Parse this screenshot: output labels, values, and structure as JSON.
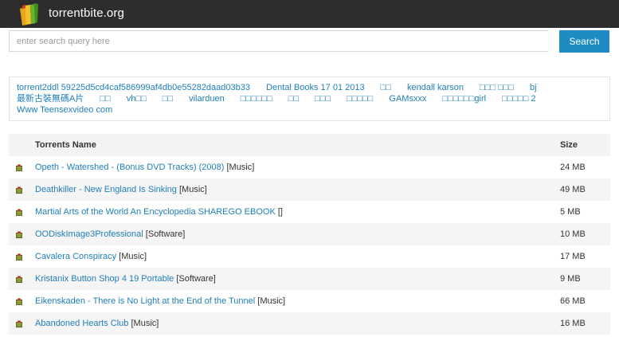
{
  "header": {
    "site_title": "torrentbite.org",
    "logo_icon": "books-logo-icon"
  },
  "search": {
    "placeholder": "enter search query here",
    "value": "",
    "button_label": "Search"
  },
  "tags": [
    "torrent2ddl 59225d5cd4caf586999af4db0e55282daad03b33",
    "Dental Books 17 01 2013",
    "□□",
    "kendall karson",
    "□□□ □□□",
    "bj",
    "最新古裝無碼A片",
    "□□",
    "vh□□",
    "□□",
    "vilarduen",
    "□□□□□□",
    "□□",
    "□□□",
    "□□□□□",
    "GAMsxxx",
    "□□□□□□girl",
    "□□□□□ 2",
    "Www Teensexvideo com"
  ],
  "table": {
    "columns": [
      "Torrents Name",
      "Size"
    ],
    "rows": [
      {
        "name": "Opeth - Watershed - (Bonus DVD Tracks) (2008)",
        "category": "[Music]",
        "size": "24 MB"
      },
      {
        "name": "Deathkiller - New England Is Sinking",
        "category": "[Music]",
        "size": "49 MB"
      },
      {
        "name": "Martial Arts of the World An Encyclopedia SHAREGO EBOOK",
        "category": "[]",
        "size": "5 MB"
      },
      {
        "name": "OODiskImage3Professional",
        "category": "[Software]",
        "size": "10 MB"
      },
      {
        "name": "Cavalera Conspiracy",
        "category": "[Music]",
        "size": "17 MB"
      },
      {
        "name": "Kristanix Button Shop 4 19 Portable",
        "category": "[Software]",
        "size": "9 MB"
      },
      {
        "name": "Eikenskaden - There is No Light at the End of the Tunnel",
        "category": "[Music]",
        "size": "66 MB"
      },
      {
        "name": "Abandoned Hearts Club",
        "category": "[Music]",
        "size": "16 MB"
      }
    ]
  },
  "colors": {
    "topbar": "#2d2d2d",
    "accent": "#1e8bc3",
    "link": "#1e7fb8",
    "table_header_bg": "#f3f3f3",
    "row_stripe": "#f5f5f5"
  }
}
